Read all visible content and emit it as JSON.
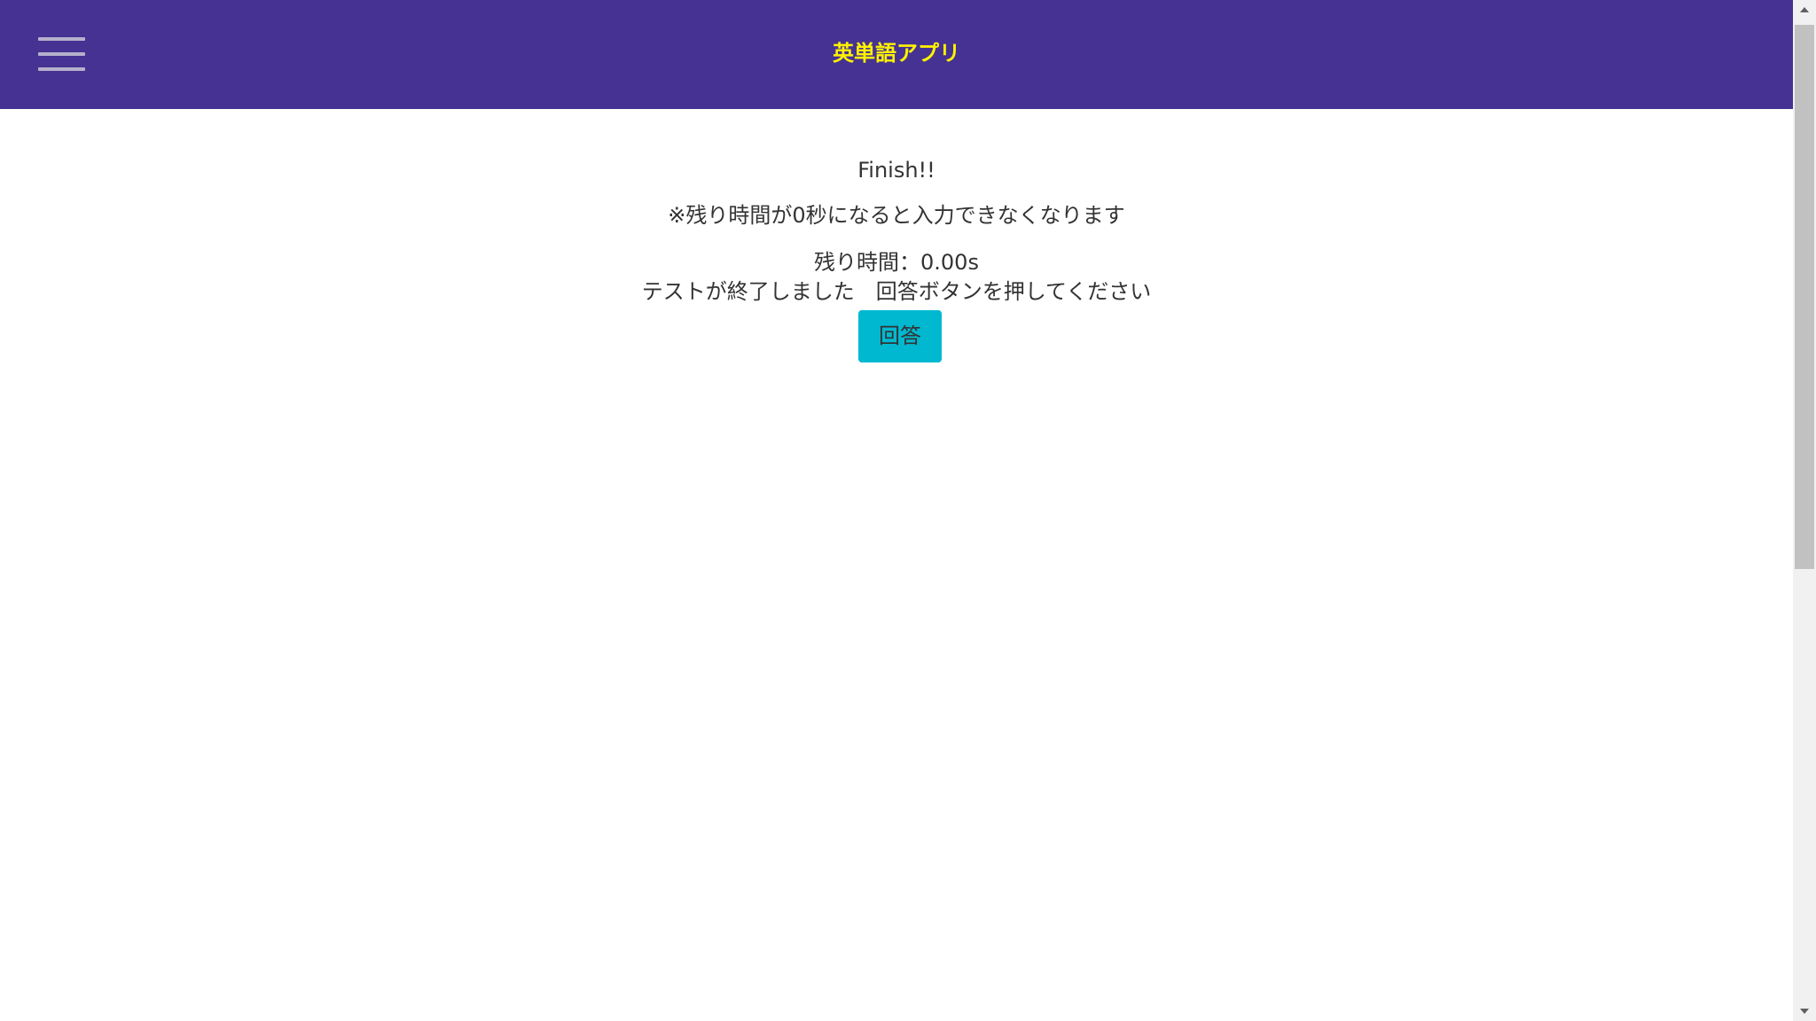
{
  "header": {
    "title": "英単語アプリ",
    "menu_icon": "hamburger-menu-icon",
    "background_color": "#453292",
    "title_color": "#fff200"
  },
  "main": {
    "finish_text": "Finish!!",
    "note_text": "※残り時間が0秒になると入力できなくなります",
    "timer_text": "残り時間：0.00s",
    "message_text": "テストが終了しました　回答ボタンを押してください",
    "answer_button_label": "回答",
    "answer_button_color": "#00b9d1"
  }
}
